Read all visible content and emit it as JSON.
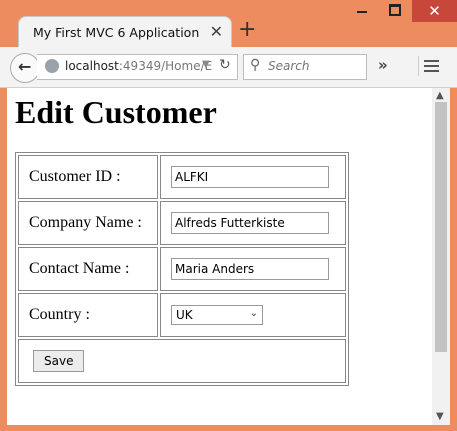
{
  "browser": {
    "tab_title": "My First MVC 6 Application",
    "new_tab_symbol": "+",
    "url_host": "localhost",
    "url_rest": ":49349/Home/E",
    "search_placeholder": "Search",
    "overflow_symbol": "»",
    "close_symbol": "✕"
  },
  "page": {
    "title": "Edit Customer",
    "fields": [
      {
        "label": "Customer ID :",
        "value": "ALFKI"
      },
      {
        "label": "Company Name :",
        "value": "Alfreds Futterkiste"
      },
      {
        "label": "Contact Name :",
        "value": "Maria Anders"
      },
      {
        "label": "Country :",
        "value": "UK"
      }
    ],
    "save_label": "Save"
  },
  "colors": {
    "window_frame": "#ec8c5f",
    "close_button": "#c7483a"
  }
}
